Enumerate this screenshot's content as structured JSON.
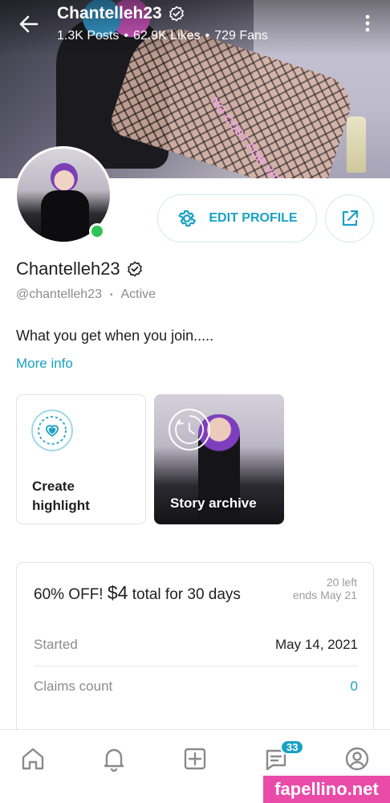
{
  "header": {
    "title": "Chantelleh23",
    "stats": {
      "posts": "1.3K Posts",
      "separator": "•",
      "likes": "62.9K Likes",
      "fans": "729 Fans"
    },
    "cover_overlay_text": "NO COST FOR VIDEOS"
  },
  "profile": {
    "display_name": "Chantelleh23",
    "handle": "@chantelleh23",
    "status": "Active",
    "bio": "What you get when you join.....",
    "more_info": "More info",
    "edit_profile_label": "EDIT PROFILE"
  },
  "highlights": [
    {
      "label_line1": "Create",
      "label_line2": "highlight"
    },
    {
      "label": "Story archive"
    }
  ],
  "promo": {
    "headline_prefix": "60% OFF!",
    "price": "$4",
    "headline_suffix": "total for 30 days",
    "left": "20 left",
    "ends": "ends May 21",
    "rows": [
      {
        "key": "Started",
        "value": "May 14, 2021"
      },
      {
        "key": "Claims count",
        "value": "0"
      }
    ]
  },
  "nav": {
    "messages_badge": "33"
  },
  "watermark": "fapellino.net",
  "colors": {
    "accent": "#1aa1c4",
    "online": "#2ec45a",
    "watermark_bg": "#ea4aa8"
  }
}
